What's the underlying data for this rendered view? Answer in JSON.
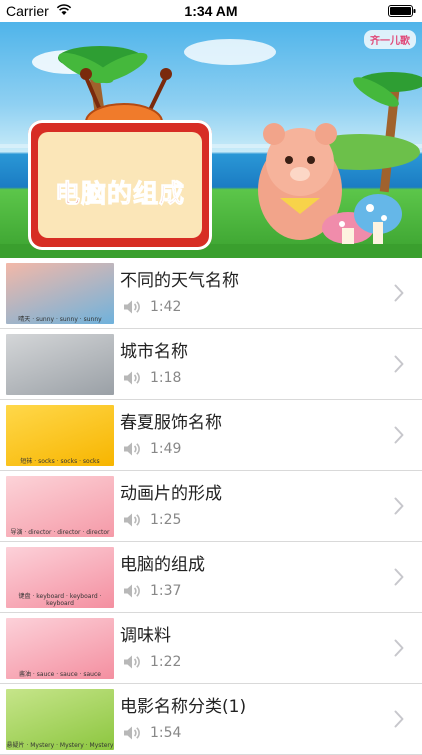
{
  "status_bar": {
    "carrier": "Carrier",
    "time": "1:34 AM"
  },
  "hero": {
    "title": "电脑的组成",
    "badge": "齐一儿歌"
  },
  "list": [
    {
      "title": "不同的天气名称",
      "duration": "1:42",
      "caption": "晴天 · sunny · sunny · sunny",
      "thumb_colors": [
        "#6fb2dc",
        "#f3b8a8"
      ]
    },
    {
      "title": "城市名称",
      "duration": "1:18",
      "caption": "",
      "thumb_colors": [
        "#9aa0a6",
        "#d4d6d8"
      ]
    },
    {
      "title": "春夏服饰名称",
      "duration": "1:49",
      "caption": "短袜 · socks · socks · socks",
      "thumb_colors": [
        "#f7b500",
        "#ffd84a"
      ]
    },
    {
      "title": "动画片的形成",
      "duration": "1:25",
      "caption": "导演 · director · director · director",
      "thumb_colors": [
        "#f59aa8",
        "#fcd3d8"
      ]
    },
    {
      "title": "电脑的组成",
      "duration": "1:37",
      "caption": "键盘 · keyboard · keyboard · keyboard",
      "thumb_colors": [
        "#f48fa0",
        "#fcd1d9"
      ]
    },
    {
      "title": "调味料",
      "duration": "1:22",
      "caption": "酱油 · sauce · sauce · sauce",
      "thumb_colors": [
        "#f48fa0",
        "#fcd1d9"
      ]
    },
    {
      "title": "电影名称分类(1)",
      "duration": "1:54",
      "caption": "悬疑片 · Mystery · Mystery · Mystery",
      "thumb_colors": [
        "#8cc63f",
        "#c6e58a"
      ]
    }
  ]
}
